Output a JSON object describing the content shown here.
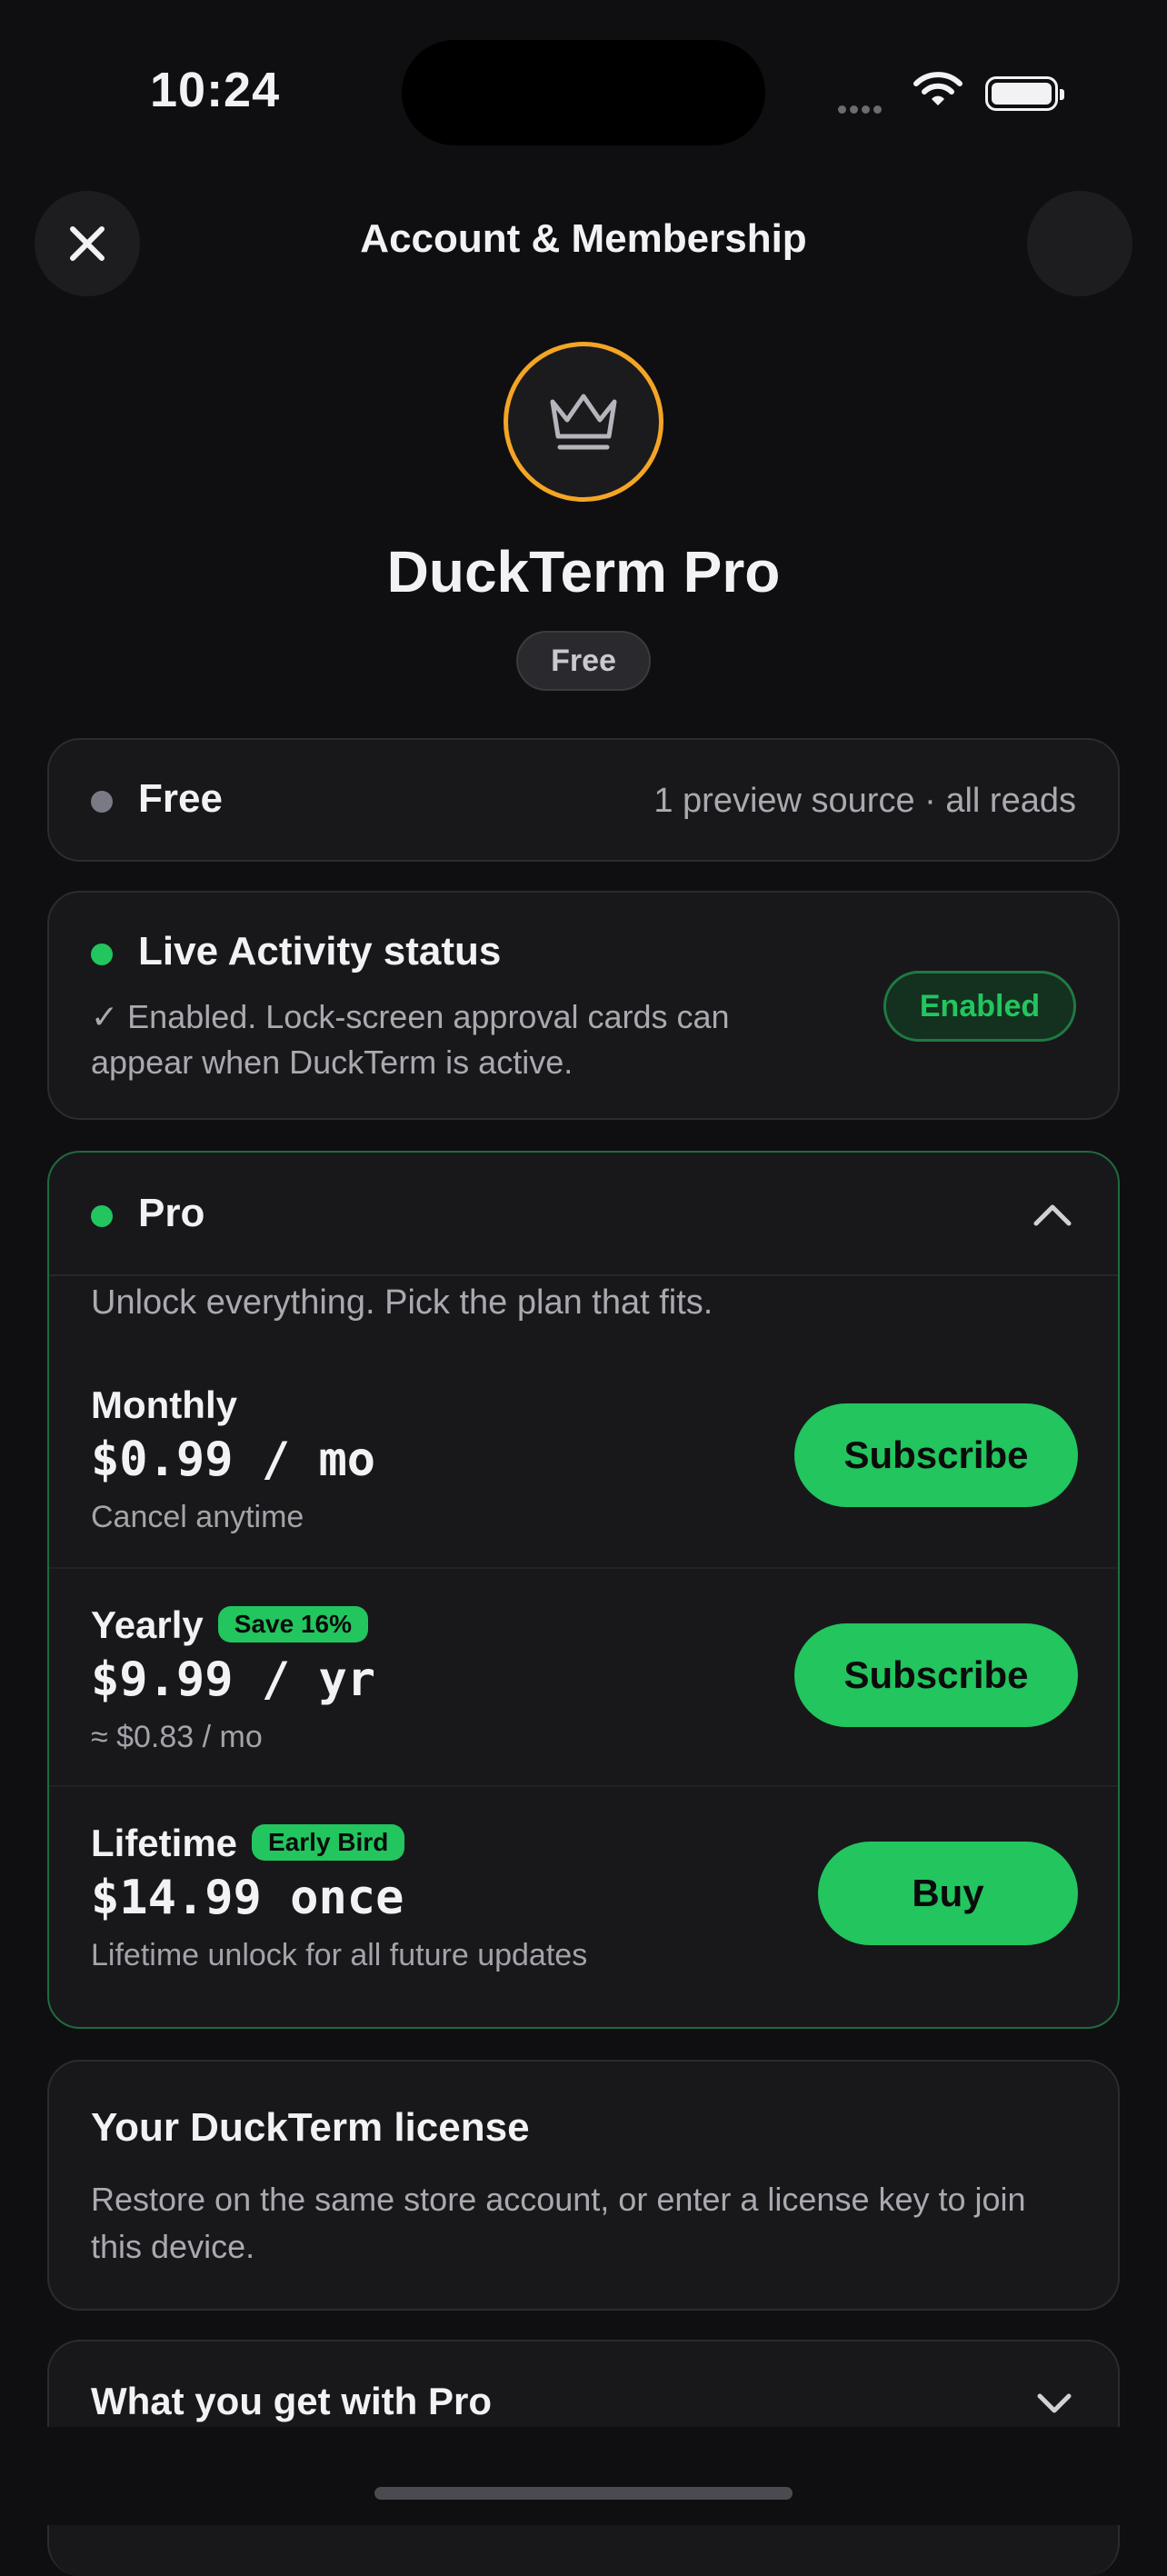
{
  "status_bar": {
    "time": "10:24"
  },
  "nav": {
    "title": "Account & Membership"
  },
  "hero": {
    "app_name": "DuckTerm Pro",
    "current_plan_pill": "Free"
  },
  "free_card": {
    "title": "Free",
    "meta": "1 preview source · all reads"
  },
  "live_activity": {
    "title": "Live Activity status",
    "description": "✓ Enabled. Lock-screen approval cards can appear when DuckTerm is active.",
    "status_pill": "Enabled"
  },
  "pro": {
    "title": "Pro",
    "subtitle": "Unlock everything. Pick the plan that fits.",
    "plans": [
      {
        "name": "Monthly",
        "badge": "",
        "price": "$0.99 / mo",
        "note": "Cancel anytime",
        "button": "Subscribe"
      },
      {
        "name": "Yearly",
        "badge": "Save 16%",
        "price": "$9.99 / yr",
        "note": "≈ $0.83 / mo",
        "button": "Subscribe"
      },
      {
        "name": "Lifetime",
        "badge": "Early Bird",
        "price": "$14.99 once",
        "note": "Lifetime unlock for all future updates",
        "button": "Buy"
      }
    ]
  },
  "license": {
    "title": "Your DuckTerm license",
    "description": "Restore on the same store account, or enter a license key to join this device."
  },
  "benefits": {
    "title": "What you get with Pro"
  },
  "colors": {
    "accent_green": "#22c55e",
    "crown_ring": "#f5a524",
    "background": "#0f0f11"
  },
  "icons": [
    "close-icon",
    "crown-icon",
    "chevron-up-icon",
    "chevron-down-icon",
    "wifi-icon",
    "battery-icon"
  ]
}
